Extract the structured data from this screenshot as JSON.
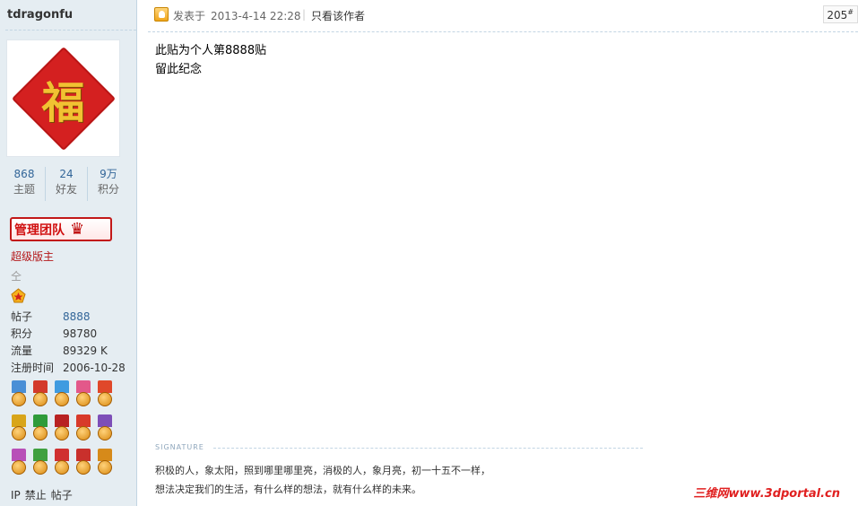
{
  "author": {
    "username": "tdragonfu",
    "avatar_char": "福",
    "stats": [
      {
        "value": "868",
        "label": "主题"
      },
      {
        "value": "24",
        "label": "好友"
      },
      {
        "value": "9万",
        "label": "积分"
      }
    ],
    "team_badge": "管理团队",
    "rank": "超级版主",
    "rank_sub": "仝",
    "info": [
      {
        "key": "帖子",
        "value": "8888"
      },
      {
        "key": "积分",
        "value": "98780"
      },
      {
        "key": "流量",
        "value": "89329 K"
      },
      {
        "key": "注册时间",
        "value": "2006-10-28"
      }
    ],
    "medals": [
      {
        "ribbon": "#4a8fd6",
        "icon": "medal-icon"
      },
      {
        "ribbon": "#d33a2c",
        "icon": "medal-icon"
      },
      {
        "ribbon": "#3f9be0",
        "icon": "medal-icon"
      },
      {
        "ribbon": "#e3588a",
        "icon": "medal-icon"
      },
      {
        "ribbon": "#e0482a",
        "icon": "medal-icon"
      },
      {
        "ribbon": "#d8a51a",
        "icon": "medal-icon"
      },
      {
        "ribbon": "#2e9b3a",
        "icon": "medal-icon"
      },
      {
        "ribbon": "#b82222",
        "icon": "medal-icon"
      },
      {
        "ribbon": "#d83a2a",
        "icon": "medal-icon"
      },
      {
        "ribbon": "#7d4fb8",
        "icon": "medal-icon"
      },
      {
        "ribbon": "#b84fb8",
        "icon": "medal-icon"
      },
      {
        "ribbon": "#3fa03f",
        "icon": "medal-icon"
      },
      {
        "ribbon": "#d03030",
        "icon": "medal-icon"
      },
      {
        "ribbon": "#c9302c",
        "icon": "medal-icon"
      },
      {
        "ribbon": "#d68a1a",
        "icon": "medal-icon"
      }
    ],
    "actions": [
      "IP",
      "禁止",
      "帖子"
    ]
  },
  "post": {
    "posted_label": "发表于",
    "timestamp": "2013-4-14 22:28",
    "only_author": "只看该作者",
    "floor": "205",
    "floor_mark": "#",
    "content_lines": [
      "此贴为个人第8888贴",
      "留此纪念"
    ],
    "signature_label": "SIGNATURE",
    "signature_lines": [
      "积极的人，象太阳，照到哪里哪里亮，消极的人，象月亮，初一十五不一样，",
      "想法决定我们的生活，有什么样的想法，就有什么样的未来。"
    ]
  },
  "watermark": {
    "cn": "三维网",
    "url": "www.3dportal.cn"
  }
}
